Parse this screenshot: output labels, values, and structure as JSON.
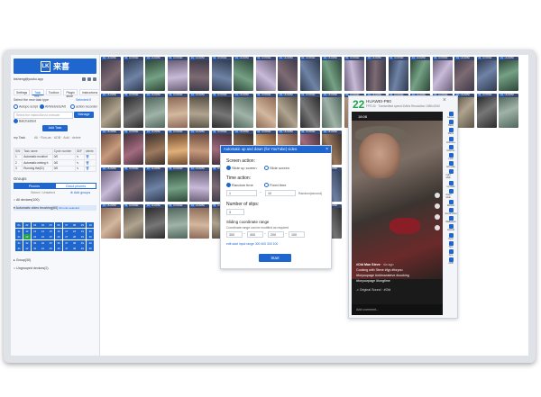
{
  "sidebar": {
    "logo_text": "来喜",
    "logo_mark": "LK",
    "account": "bisheng@youku.app",
    "tabs": [
      "Settings",
      "Task ma...",
      "Toolbox",
      "Plugin store",
      "Instructions"
    ],
    "select_label": "Select the new task type",
    "selected_label": "Selected:0",
    "task_types": [
      "Autopo script",
      "AI/Web/etc/Alt",
      "action recorder"
    ],
    "instruction_placeholder": "Select the instruction to execute",
    "manage_button": "Manage",
    "import_label": "Batchadded",
    "add_task_button": "Add Task",
    "my_task_label": "my Task",
    "my_task_options": [
      "All",
      "Run-as",
      "ADB",
      "Add",
      "delete"
    ],
    "table_headers": [
      "S/N",
      "Task name",
      "Cycle number",
      "ID/F",
      "delete"
    ],
    "table_rows": [
      {
        "sn": "1",
        "name": "Automatic monitori",
        "cycle": "0/0"
      },
      {
        "sn": "2",
        "name": "Automatic mining b",
        "cycle": "0/0"
      },
      {
        "sn": "3",
        "name": "Running the(ID)",
        "cycle": "0/0"
      }
    ],
    "groups_label": "Groups",
    "seg_phones": "Phones",
    "seg_cloud": "Cloud phones",
    "select_unselect": "Select / Unselect",
    "add_groups": "Add groups",
    "all_devices": "All devices(100)",
    "auto_group": "Automatic video brushing(60)",
    "auto_group_count": "60 units selected",
    "group_sub": "Group(30)",
    "ungrouped": "Ungrouped devices(2)",
    "device_numbers": [
      "01",
      "02",
      "03",
      "04",
      "05",
      "06",
      "07",
      "08",
      "09",
      "10",
      "11",
      "12",
      "13",
      "14",
      "15",
      "16",
      "17",
      "18",
      "19",
      "20",
      "21",
      "22",
      "23",
      "24",
      "25",
      "26",
      "27",
      "28",
      "29",
      "30",
      "31",
      "32",
      "33",
      "34",
      "35",
      "36",
      "37",
      "38",
      "39",
      "40",
      "41",
      "42",
      "43",
      "44",
      "45",
      "46",
      "47",
      "48",
      "49",
      "50"
    ]
  },
  "thumb_caption_prefix": "01",
  "thumb_caption_model": "HUAWEI",
  "modal": {
    "title": "Automatic up and down (for YouTube) video",
    "close": "×",
    "screen_action_label": "Screen action:",
    "screen_opt1": "Slide up screen",
    "screen_opt2": "Slide screen",
    "time_action_label": "Time action:",
    "time_opt1": "Random time",
    "time_opt2": "Fixed time",
    "time_min": "1",
    "time_max": "10",
    "time_unit": "Random(second)",
    "slips_label": "Number of slips:",
    "slips_value": "3",
    "sliding_label": "Sliding coordinate range",
    "sliding_hint": "Coordinate range can be modified as required",
    "coords": [
      "300",
      "400",
      "200",
      "100"
    ],
    "edit_link": "edit start input range 300 400 300 100",
    "start_button": "Start"
  },
  "phone": {
    "number": "22",
    "model": "HUAWEI-P80",
    "sub": "FPS:30 · Transmitted speed:1Mb/s Resolution:1080x2340",
    "close": "×",
    "time": "18:08",
    "tag1": "#Old Man Steve",
    "tag1_extra": "· 4w ago",
    "caption1": "Cooking with Steve #fyp #foryou",
    "caption2": "#foryoupage #oldmansteve #cooking",
    "caption3": "#foryourpage #longtime",
    "music": "♫ Original Sound · #Old",
    "comment_placeholder": "Add comment...",
    "tools": [
      "Home",
      "Back",
      "Menu",
      "Volume+",
      "Volume-",
      "Lock",
      "left slide",
      "right slide",
      "up slide",
      "down slide",
      "Restart",
      "Screenshot",
      "Wallpaper",
      "Upload",
      "Sync",
      "Text",
      "App",
      "ADB"
    ]
  }
}
